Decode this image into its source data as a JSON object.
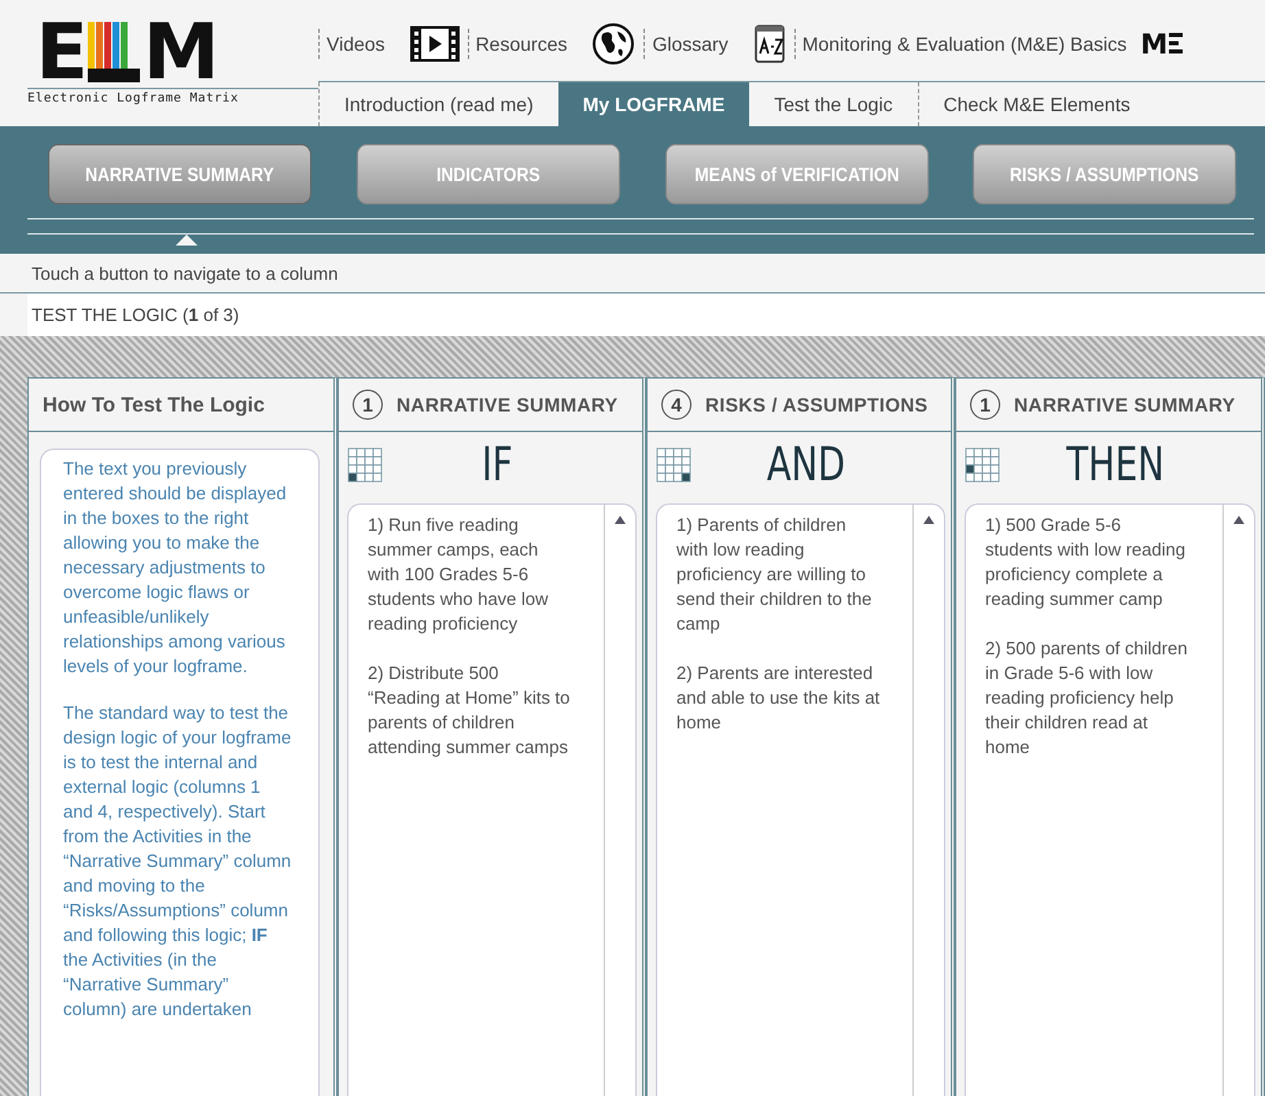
{
  "logo": {
    "first_letter": "E",
    "last_letter": "M",
    "tagline": "Electronic Logframe Matrix"
  },
  "top_links": [
    {
      "label": "Videos"
    },
    {
      "label": "Resources"
    },
    {
      "label": "Glossary"
    },
    {
      "label": "Monitoring & Evaluation (M&E) Basics"
    }
  ],
  "brand_mark": "M",
  "tabs": [
    {
      "label": "Introduction (read me)",
      "selected": false
    },
    {
      "label": "My LOGFRAME",
      "selected": true
    },
    {
      "label": "Test the Logic",
      "selected": false
    },
    {
      "label": "Check M&E Elements",
      "selected": false
    }
  ],
  "column_buttons": [
    {
      "label": "NARRATIVE SUMMARY",
      "selected": true
    },
    {
      "label": "INDICATORS",
      "selected": false
    },
    {
      "label": "MEANS of VERIFICATION",
      "selected": false
    },
    {
      "label": "RISKS / ASSUMPTIONS",
      "selected": false
    }
  ],
  "hint": "Touch a button to navigate to a column",
  "step_title": "TEST THE LOGIC (**1** of 3)",
  "help": {
    "title": "How To Test The Logic",
    "paragraphs": [
      "The text you previously entered should be displayed in the boxes to the right allowing you to make the necessary adjustments to overcome logic flaws or unfeasible/unlikely relationships among various levels of your logframe.",
      "The standard way to test the design logic of your logframe is to test the internal and external logic (columns 1 and 4, respectively). Start from the Activities in the “Narrative Summary” column and moving to the “Risks/Assumptions” column and following this logic; **IF** the Activities (in the “Narrative Summary” column) are undertaken"
    ]
  },
  "columns": [
    {
      "number": "1",
      "title": "NARRATIVE SUMMARY",
      "word": "IF",
      "items": [
        "1) Run five reading summer camps, each with 100 Grades 5-6 students who have low reading proficiency",
        "2) Distribute 500 “Reading at Home” kits to parents of children attending summer camps"
      ]
    },
    {
      "number": "4",
      "title": "RISKS / ASSUMPTIONS",
      "word": "AND",
      "items": [
        "1) Parents of children with low reading proficiency are willing to send their children to the camp",
        "2) Parents are interested and able to use the kits at home"
      ]
    },
    {
      "number": "1",
      "title": "NARRATIVE SUMMARY",
      "word": "THEN",
      "items": [
        "1) 500 Grade 5-6 students with low reading proficiency complete a reading summer camp",
        "2) 500 parents of children in Grade 5-6 with low reading proficiency help their children read at home"
      ]
    }
  ]
}
